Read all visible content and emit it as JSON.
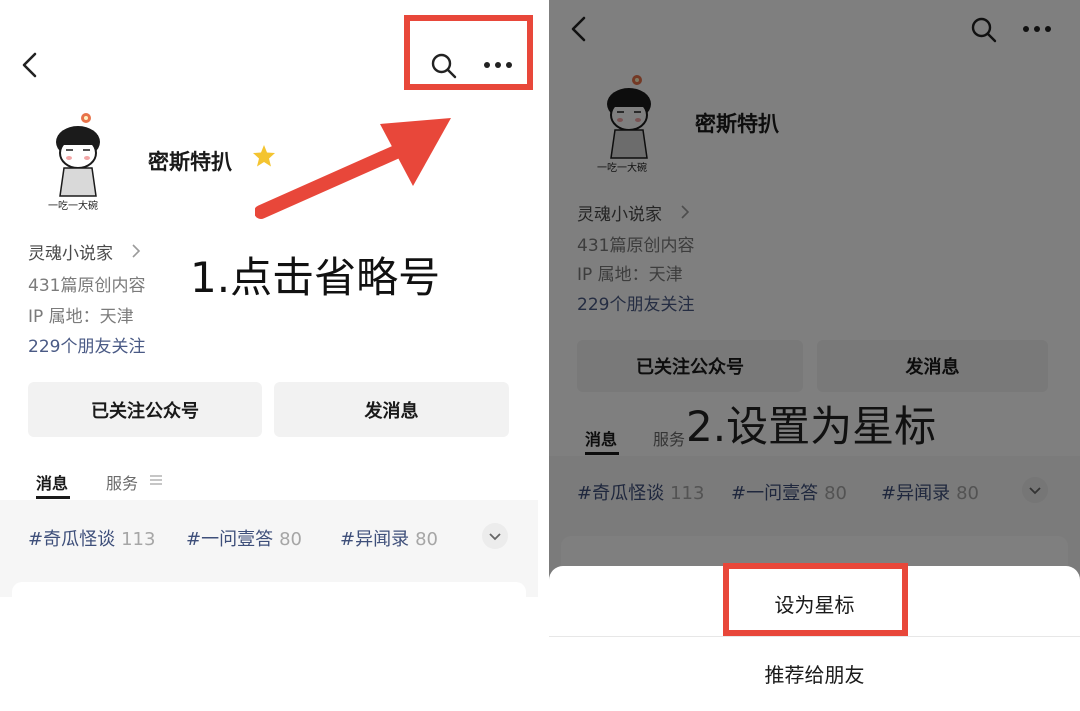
{
  "colors": {
    "accent_red": "#e8473a",
    "link_blue": "#4a5a85",
    "tag_blue": "#3e4f7a",
    "star_yellow": "#f4c430"
  },
  "profile": {
    "name": "密斯特扒",
    "avatar_caption": "一吃一大碗",
    "category": "灵魂小说家",
    "article_count": "431篇原创内容",
    "ip_location": "IP 属地：天津",
    "friends_following": "229个朋友关注"
  },
  "actions": {
    "follow_label": "已关注公众号",
    "message_label": "发消息"
  },
  "tabs": [
    {
      "label": "消息"
    },
    {
      "label": "服务"
    }
  ],
  "tags": [
    {
      "name": "#奇瓜怪谈",
      "count": "113"
    },
    {
      "name": "#一问壹答",
      "count": "80"
    },
    {
      "name": "#异闻录",
      "count": "80"
    }
  ],
  "sheet": {
    "items": [
      {
        "label": "设为星标"
      },
      {
        "label": "推荐给朋友"
      }
    ]
  },
  "instructions": {
    "step1": "1.点击省略号",
    "step2": "2.设置为星标"
  },
  "icons": [
    "back-arrow-icon",
    "search-icon",
    "more-icon",
    "star-icon",
    "chevron-right-icon",
    "menu-lines-icon",
    "chevron-down-icon"
  ]
}
